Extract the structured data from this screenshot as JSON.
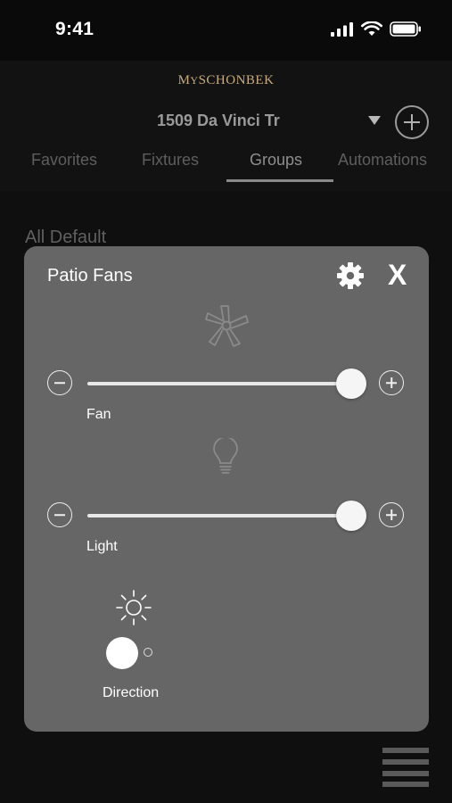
{
  "status": {
    "time": "9:41"
  },
  "brand": {
    "prefix": "M",
    "prefix_small": "Y",
    "name": "SCHONBEK"
  },
  "header": {
    "location": "1509 Da Vinci Tr"
  },
  "tabs": [
    {
      "label": "Favorites",
      "active": false
    },
    {
      "label": "Fixtures",
      "active": false
    },
    {
      "label": "Groups",
      "active": true
    },
    {
      "label": "Automations",
      "active": false
    }
  ],
  "group": {
    "name": "All Default"
  },
  "modal": {
    "title": "Patio Fans",
    "close_label": "X",
    "fan": {
      "label": "Fan",
      "level_percent": 100
    },
    "light": {
      "label": "Light",
      "level_percent": 100
    },
    "direction": {
      "label": "Direction",
      "on": true
    }
  },
  "icons": {
    "gear": "gear-icon",
    "fan": "fan-icon",
    "bulb": "lightbulb-icon",
    "sun": "sun-icon",
    "menu": "hamburger-menu-icon"
  },
  "colors": {
    "background": "#0a0a0a",
    "modal": "#666666",
    "brand": "#c8ad80"
  }
}
